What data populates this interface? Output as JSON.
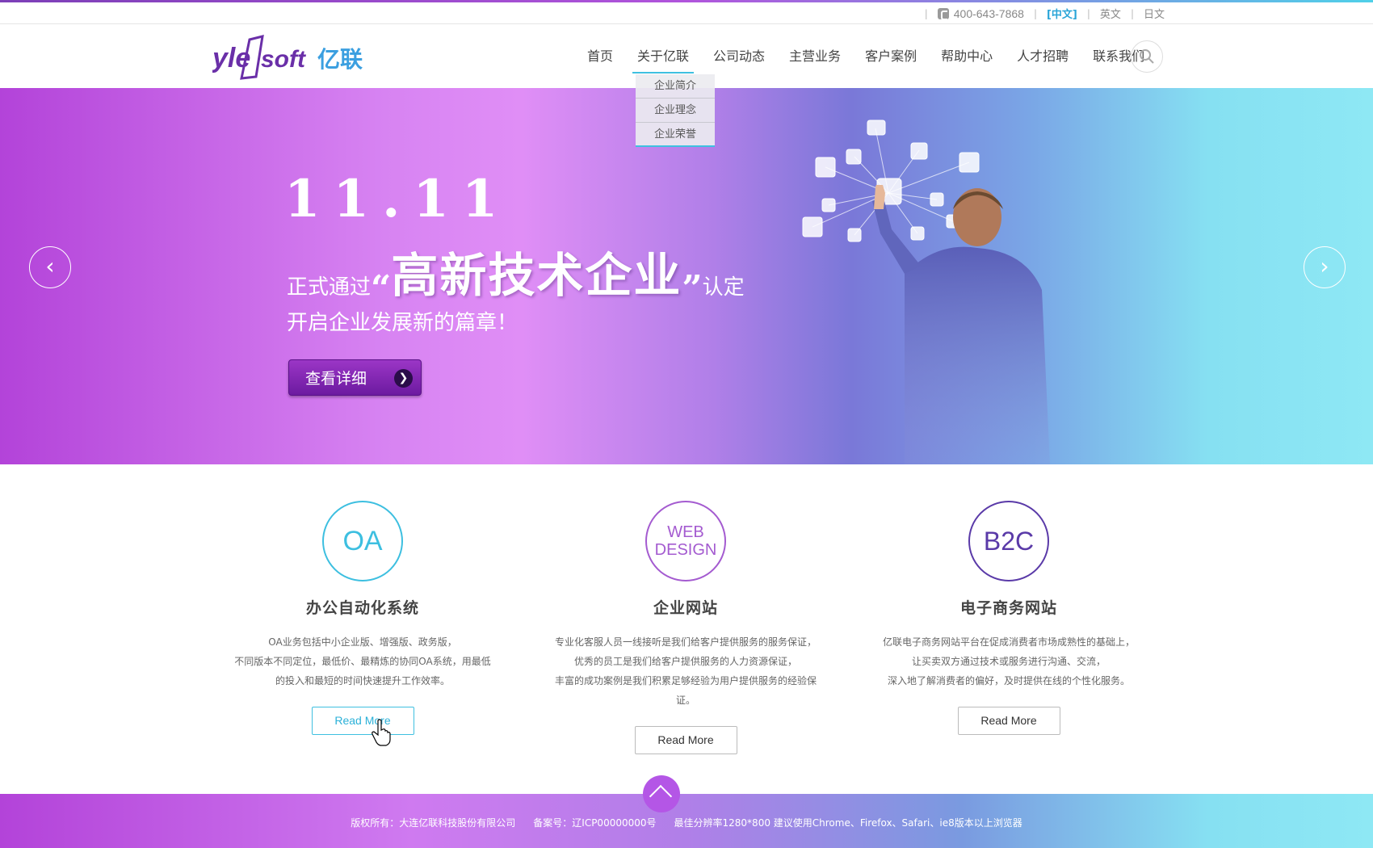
{
  "topbar": {
    "phone": "400-643-7868",
    "languages": [
      "[中文]",
      "英文",
      "日文"
    ]
  },
  "header": {
    "logo_text": "yle soft 亿联",
    "nav": [
      "首页",
      "关于亿联",
      "公司动态",
      "主营业务",
      "客户案例",
      "帮助中心",
      "人才招聘",
      "联系我们"
    ],
    "active_nav": "关于亿联",
    "dropdown": [
      "企业简介",
      "企业理念",
      "企业荣誉"
    ]
  },
  "banner": {
    "date": "11.11",
    "prefix": "正式通过",
    "quote_open": "“",
    "headline": "高新技术企业",
    "quote_close": "”",
    "suffix": "认定",
    "subline": "开启企业发展新的篇章！",
    "button_label": "查看详细",
    "arrow_left": "‹",
    "arrow_right": "›"
  },
  "services": [
    {
      "icon_text": "OA",
      "color": "#3dbfe0",
      "title": "办公自动化系统",
      "desc": [
        "OA业务包括中小企业版、增强版、政务版，",
        "不同版本不同定位，最低价、最精炼的协同OA系统，用最低",
        "的投入和最短的时间快速提升工作效率。"
      ],
      "more": "Read More"
    },
    {
      "icon_text_1": "WEB",
      "icon_text_2": "DESIGN",
      "color": "#a45bd0",
      "title": "企业网站",
      "desc": [
        "专业化客服人员一线接听是我们给客户提供服务的服务保证，",
        "优秀的员工是我们给客户提供服务的人力资源保证，",
        "丰富的成功案例是我们积累足够经验为用户提供服务的经验保证。"
      ],
      "more": "Read More"
    },
    {
      "icon_text": "B2C",
      "color": "#5a3aa8",
      "title": "电子商务网站",
      "desc": [
        "亿联电子商务网站平台在促成消费者市场成熟性的基础上，",
        "让买卖双方通过技术或服务进行沟通、交流，",
        "深入地了解消费者的偏好，及时提供在线的个性化服务。"
      ],
      "more": "Read More"
    }
  ],
  "footer": {
    "copyright": "版权所有：大连亿联科技股份有限公司",
    "icp": "备案号：辽ICP00000000号",
    "browser": "最佳分辨率1280*800  建议使用Chrome、Firefox、Safari、ie8版本以上浏览器"
  }
}
